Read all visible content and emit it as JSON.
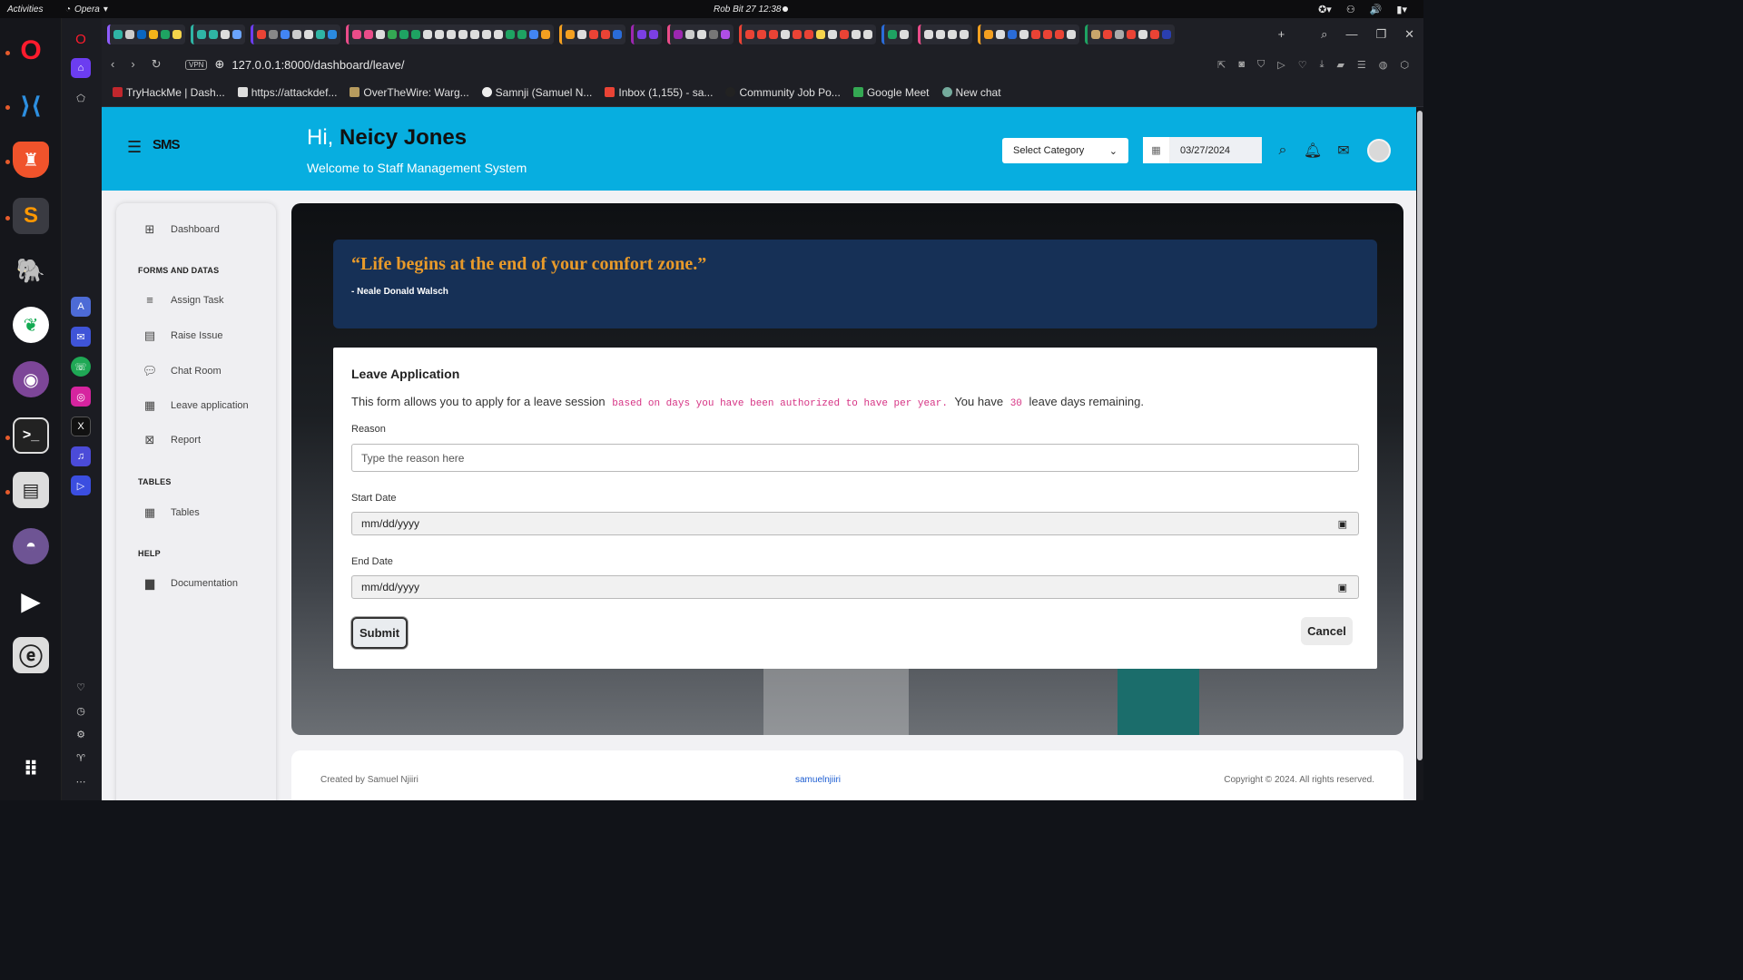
{
  "topbar": {
    "activities": "Activities",
    "app": "Opera",
    "clock": "Rob Bit 27  12:38"
  },
  "dock": {
    "apps": [
      "opera-icon",
      "vscode-icon",
      "brave-icon",
      "sublime-icon",
      "postgres-icon",
      "mongodb-icon",
      "tor-icon",
      "terminal-icon",
      "archive-icon",
      "github-icon",
      "player-icon",
      "editor-icon",
      "apps-grid-icon"
    ]
  },
  "browser": {
    "url": "127.0.0.1:8000/dashboard/leave/",
    "bookmarks": [
      "TryHackMe | Dash...",
      "https://attackdef...",
      "OverTheWire: Warg...",
      "Samnji (Samuel N...",
      "Inbox (1,155) - sa...",
      "Community Job Po...",
      "Google Meet",
      "New chat"
    ]
  },
  "header": {
    "logo": "SMS",
    "greeting": "Hi,",
    "user_name": "Neicy Jones",
    "welcome": "Welcome to Staff Management System",
    "category_select": "Select Category",
    "date": "03/27/2024"
  },
  "sidebar": {
    "dashboard": "Dashboard",
    "section_forms": "FORMS AND DATAS",
    "assign_task": "Assign Task",
    "raise_issue": "Raise Issue",
    "chat_room": "Chat Room",
    "leave_application": "Leave application",
    "report": "Report",
    "section_tables": "TABLES",
    "tables": "Tables",
    "section_help": "HELP",
    "documentation": "Documentation"
  },
  "quote": {
    "text": "“Life begins at the end of your comfort zone.”",
    "author": "- Neale Donald Walsch"
  },
  "form": {
    "title": "Leave Application",
    "desc_start": "This form allows you to apply for a leave session",
    "desc_code": "based on days you have been authorized to have per year.",
    "desc_mid": "You have",
    "days": "30",
    "desc_end": "leave days remaining.",
    "reason_label": "Reason",
    "reason_placeholder": "Type the reason here",
    "start_label": "Start Date",
    "start_value": "mm/dd/yyyy",
    "end_label": "End Date",
    "end_value": "mm/dd/yyyy",
    "submit": "Submit",
    "cancel": "Cancel"
  },
  "footer": {
    "left": "Created by Samuel Njiiri",
    "center": "samuelnjiiri",
    "right": "Copyright © 2024. All rights reserved."
  },
  "colors": {
    "header": "#07aee0",
    "quote_bg": "#163056",
    "quote_text": "#e89a2a",
    "code": "#d63384"
  }
}
